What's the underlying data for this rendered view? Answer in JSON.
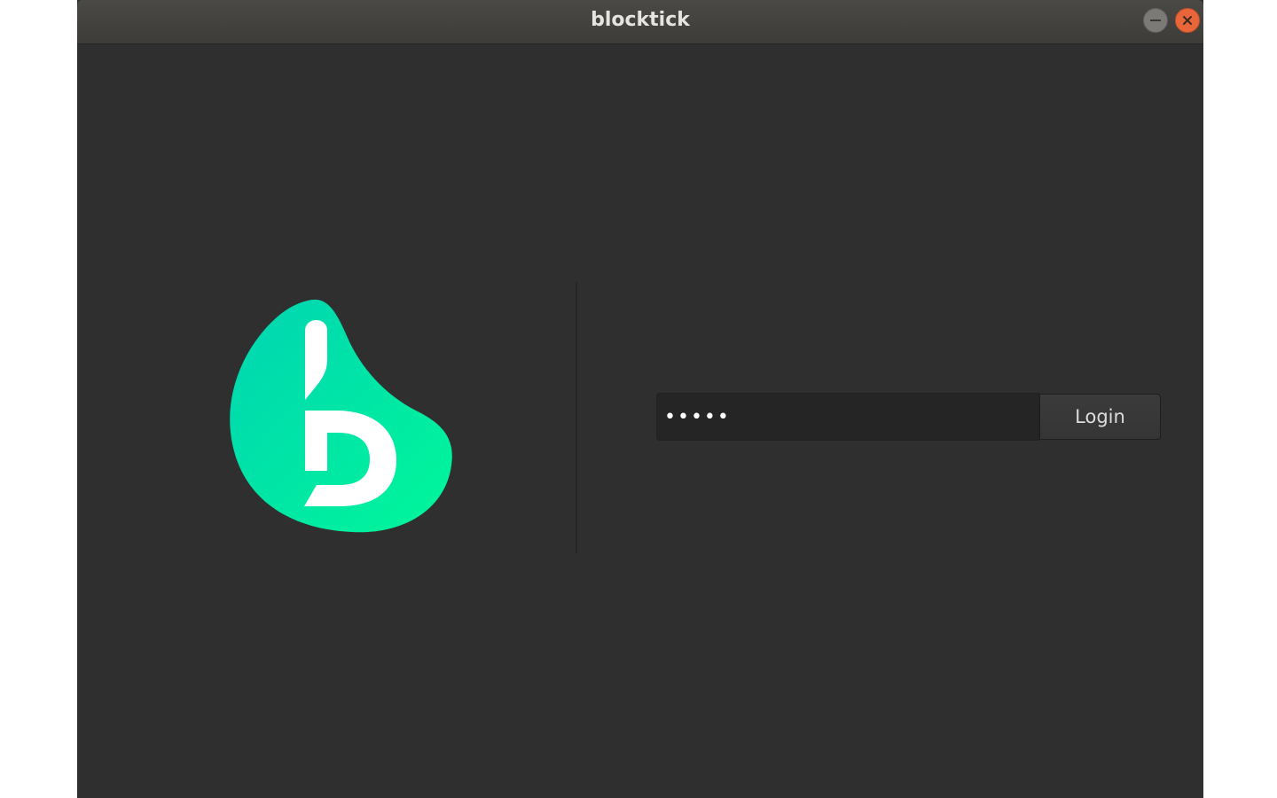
{
  "window": {
    "title": "blocktick"
  },
  "login": {
    "password_value": "•••••",
    "button_label": "Login"
  },
  "logo": {
    "icon": "blocktick-logo",
    "colors": {
      "gradient_start": "#00d4a8",
      "gradient_end": "#00f59a",
      "letter": "#ffffff"
    }
  },
  "colors": {
    "background": "#2f2f2f",
    "titlebar": "#3d3c39",
    "close_button": "#e9663b",
    "input_background": "#252525"
  }
}
